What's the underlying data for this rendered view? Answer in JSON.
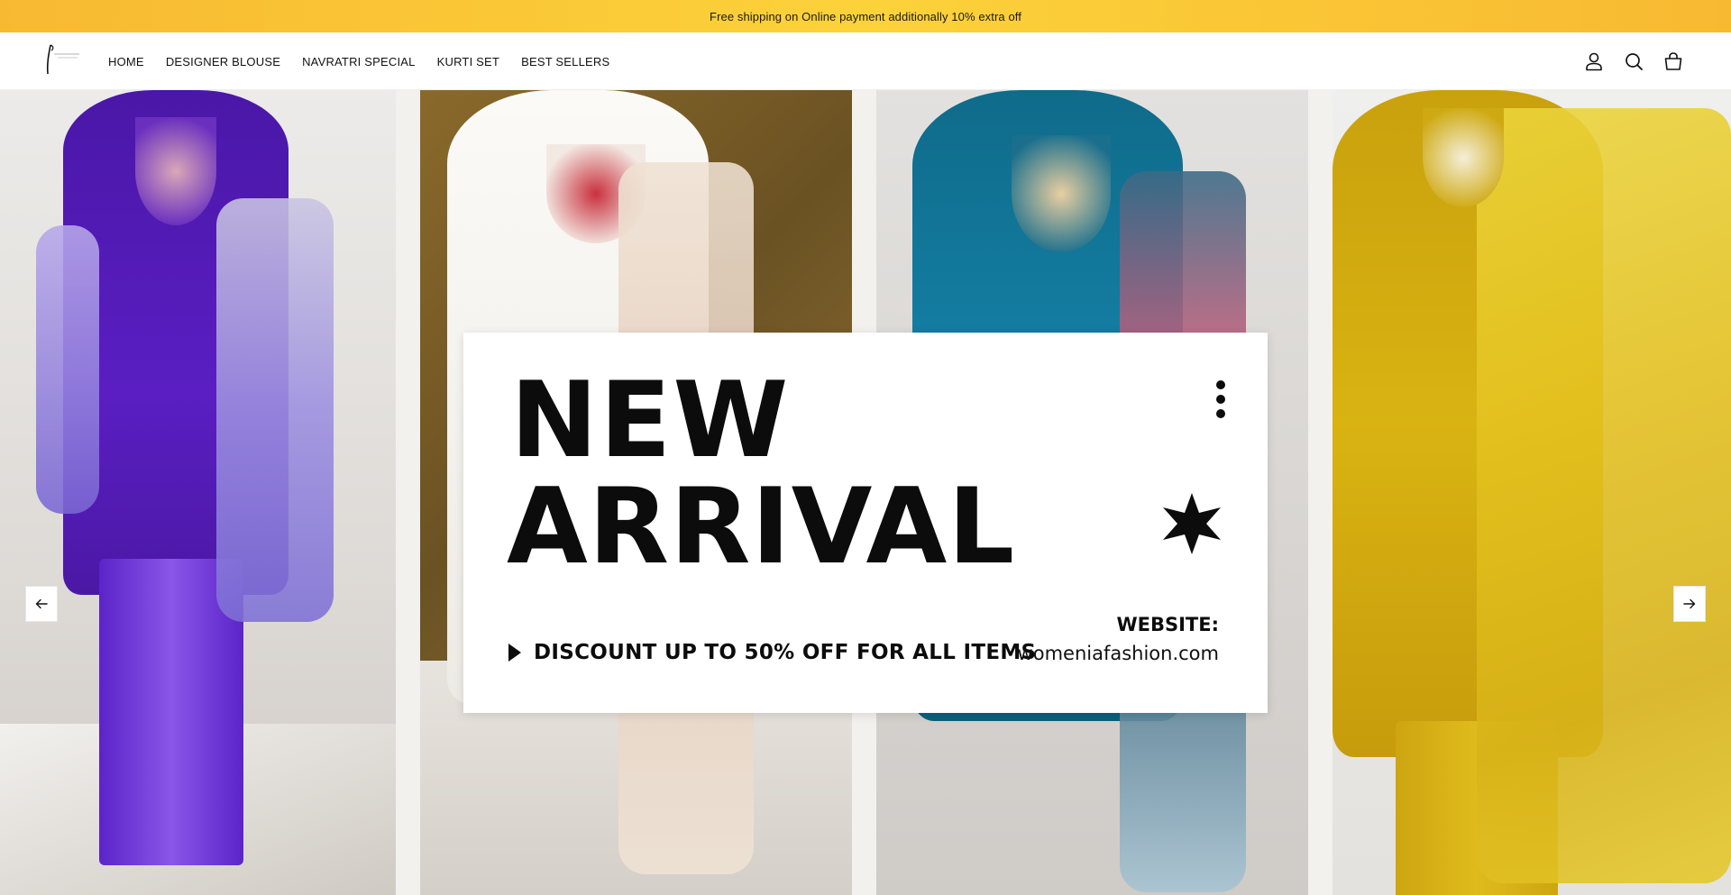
{
  "announcement": {
    "text": "Free shipping on Online payment additionally 10% extra off"
  },
  "header": {
    "logo_icon": "brand-logo",
    "nav": [
      {
        "label": "HOME"
      },
      {
        "label": "DESIGNER BLOUSE"
      },
      {
        "label": "NAVRATRI SPECIAL"
      },
      {
        "label": "KURTI SET"
      },
      {
        "label": "BEST SELLERS"
      }
    ],
    "icons": [
      "account-icon",
      "search-icon",
      "cart-icon"
    ]
  },
  "hero": {
    "banner": {
      "line1": "NEW",
      "line2": "ARRIVAL",
      "discount": "DISCOUNT UP TO 50% OFF FOR ALL ITEMS",
      "website_label": "WEBSITE:",
      "website_url": "womeniafashion.com"
    },
    "panels": [
      {
        "color_name": "purple",
        "garment_color": "#5a1ec2",
        "dupatta_color": "#9c8fe0"
      },
      {
        "color_name": "white",
        "garment_color": "#f6f3ee",
        "dupatta_color": "#ead9c9"
      },
      {
        "color_name": "teal",
        "garment_color": "#14708f",
        "dupatta_color": "#2e5e76"
      },
      {
        "color_name": "yellow",
        "garment_color": "#d9b312",
        "dupatta_color": "#e8c521"
      }
    ],
    "prev_icon": "arrow-left-icon",
    "next_icon": "arrow-right-icon"
  },
  "colors": {
    "announcement_bg": "#fcd23a",
    "text": "#121212"
  }
}
